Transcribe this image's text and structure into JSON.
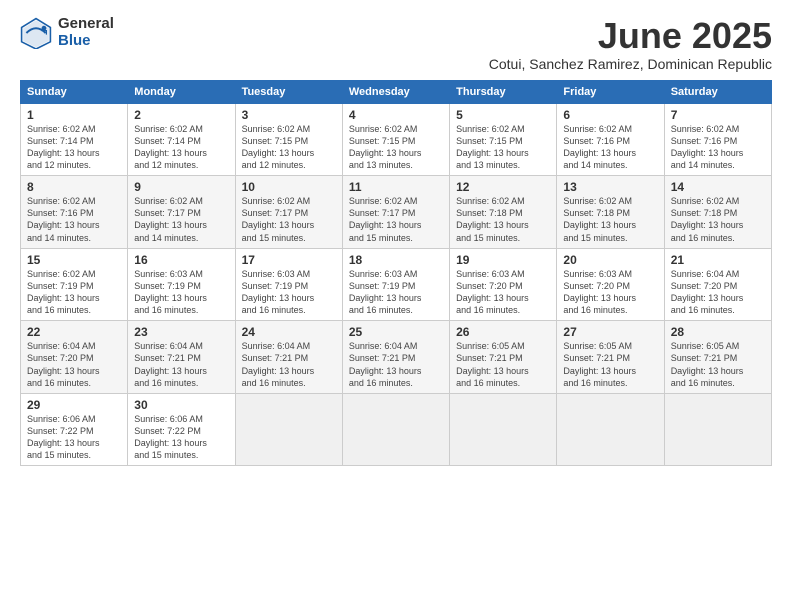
{
  "header": {
    "logo_general": "General",
    "logo_blue": "Blue",
    "main_title": "June 2025",
    "subtitle": "Cotui, Sanchez Ramirez, Dominican Republic"
  },
  "days_of_week": [
    "Sunday",
    "Monday",
    "Tuesday",
    "Wednesday",
    "Thursday",
    "Friday",
    "Saturday"
  ],
  "weeks": [
    [
      {
        "day": "1",
        "info": "Sunrise: 6:02 AM\nSunset: 7:14 PM\nDaylight: 13 hours\nand 12 minutes."
      },
      {
        "day": "2",
        "info": "Sunrise: 6:02 AM\nSunset: 7:14 PM\nDaylight: 13 hours\nand 12 minutes."
      },
      {
        "day": "3",
        "info": "Sunrise: 6:02 AM\nSunset: 7:15 PM\nDaylight: 13 hours\nand 12 minutes."
      },
      {
        "day": "4",
        "info": "Sunrise: 6:02 AM\nSunset: 7:15 PM\nDaylight: 13 hours\nand 13 minutes."
      },
      {
        "day": "5",
        "info": "Sunrise: 6:02 AM\nSunset: 7:15 PM\nDaylight: 13 hours\nand 13 minutes."
      },
      {
        "day": "6",
        "info": "Sunrise: 6:02 AM\nSunset: 7:16 PM\nDaylight: 13 hours\nand 14 minutes."
      },
      {
        "day": "7",
        "info": "Sunrise: 6:02 AM\nSunset: 7:16 PM\nDaylight: 13 hours\nand 14 minutes."
      }
    ],
    [
      {
        "day": "8",
        "info": "Sunrise: 6:02 AM\nSunset: 7:16 PM\nDaylight: 13 hours\nand 14 minutes."
      },
      {
        "day": "9",
        "info": "Sunrise: 6:02 AM\nSunset: 7:17 PM\nDaylight: 13 hours\nand 14 minutes."
      },
      {
        "day": "10",
        "info": "Sunrise: 6:02 AM\nSunset: 7:17 PM\nDaylight: 13 hours\nand 15 minutes."
      },
      {
        "day": "11",
        "info": "Sunrise: 6:02 AM\nSunset: 7:17 PM\nDaylight: 13 hours\nand 15 minutes."
      },
      {
        "day": "12",
        "info": "Sunrise: 6:02 AM\nSunset: 7:18 PM\nDaylight: 13 hours\nand 15 minutes."
      },
      {
        "day": "13",
        "info": "Sunrise: 6:02 AM\nSunset: 7:18 PM\nDaylight: 13 hours\nand 15 minutes."
      },
      {
        "day": "14",
        "info": "Sunrise: 6:02 AM\nSunset: 7:18 PM\nDaylight: 13 hours\nand 16 minutes."
      }
    ],
    [
      {
        "day": "15",
        "info": "Sunrise: 6:02 AM\nSunset: 7:19 PM\nDaylight: 13 hours\nand 16 minutes."
      },
      {
        "day": "16",
        "info": "Sunrise: 6:03 AM\nSunset: 7:19 PM\nDaylight: 13 hours\nand 16 minutes."
      },
      {
        "day": "17",
        "info": "Sunrise: 6:03 AM\nSunset: 7:19 PM\nDaylight: 13 hours\nand 16 minutes."
      },
      {
        "day": "18",
        "info": "Sunrise: 6:03 AM\nSunset: 7:19 PM\nDaylight: 13 hours\nand 16 minutes."
      },
      {
        "day": "19",
        "info": "Sunrise: 6:03 AM\nSunset: 7:20 PM\nDaylight: 13 hours\nand 16 minutes."
      },
      {
        "day": "20",
        "info": "Sunrise: 6:03 AM\nSunset: 7:20 PM\nDaylight: 13 hours\nand 16 minutes."
      },
      {
        "day": "21",
        "info": "Sunrise: 6:04 AM\nSunset: 7:20 PM\nDaylight: 13 hours\nand 16 minutes."
      }
    ],
    [
      {
        "day": "22",
        "info": "Sunrise: 6:04 AM\nSunset: 7:20 PM\nDaylight: 13 hours\nand 16 minutes."
      },
      {
        "day": "23",
        "info": "Sunrise: 6:04 AM\nSunset: 7:21 PM\nDaylight: 13 hours\nand 16 minutes."
      },
      {
        "day": "24",
        "info": "Sunrise: 6:04 AM\nSunset: 7:21 PM\nDaylight: 13 hours\nand 16 minutes."
      },
      {
        "day": "25",
        "info": "Sunrise: 6:04 AM\nSunset: 7:21 PM\nDaylight: 13 hours\nand 16 minutes."
      },
      {
        "day": "26",
        "info": "Sunrise: 6:05 AM\nSunset: 7:21 PM\nDaylight: 13 hours\nand 16 minutes."
      },
      {
        "day": "27",
        "info": "Sunrise: 6:05 AM\nSunset: 7:21 PM\nDaylight: 13 hours\nand 16 minutes."
      },
      {
        "day": "28",
        "info": "Sunrise: 6:05 AM\nSunset: 7:21 PM\nDaylight: 13 hours\nand 16 minutes."
      }
    ],
    [
      {
        "day": "29",
        "info": "Sunrise: 6:06 AM\nSunset: 7:22 PM\nDaylight: 13 hours\nand 15 minutes."
      },
      {
        "day": "30",
        "info": "Sunrise: 6:06 AM\nSunset: 7:22 PM\nDaylight: 13 hours\nand 15 minutes."
      },
      {
        "day": "",
        "info": ""
      },
      {
        "day": "",
        "info": ""
      },
      {
        "day": "",
        "info": ""
      },
      {
        "day": "",
        "info": ""
      },
      {
        "day": "",
        "info": ""
      }
    ]
  ]
}
